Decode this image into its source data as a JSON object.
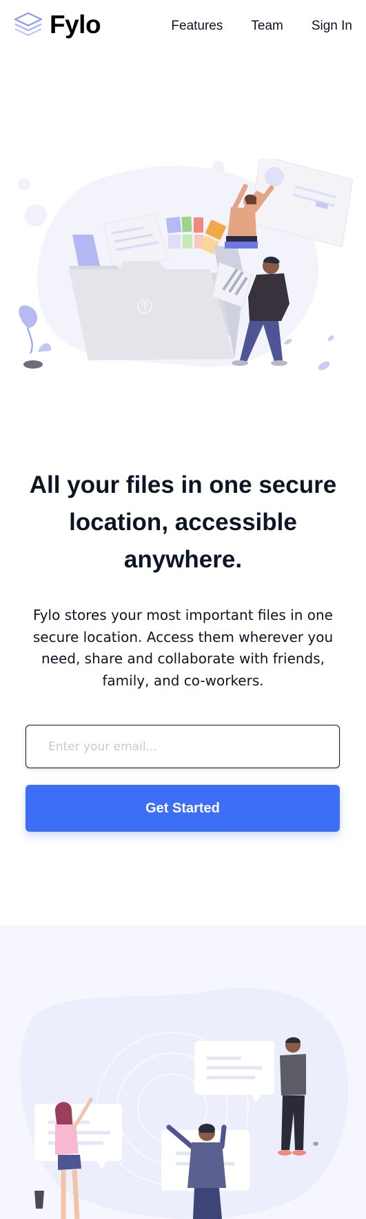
{
  "header": {
    "logo_text": "Fylo",
    "nav": [
      {
        "label": "Features"
      },
      {
        "label": "Team"
      },
      {
        "label": "Sign In"
      }
    ]
  },
  "hero": {
    "title": "All your files in one secure location, accessible anywhere.",
    "text": "Fylo stores your most important files in one secure location. Access them wherever you need, share and collaborate with friends, family, and co-workers.",
    "email_placeholder": "Enter your email...",
    "button_label": "Get Started"
  },
  "colors": {
    "accent": "#3c6ef7",
    "text": "#0c1524",
    "section_background": "#f5f6fe"
  }
}
